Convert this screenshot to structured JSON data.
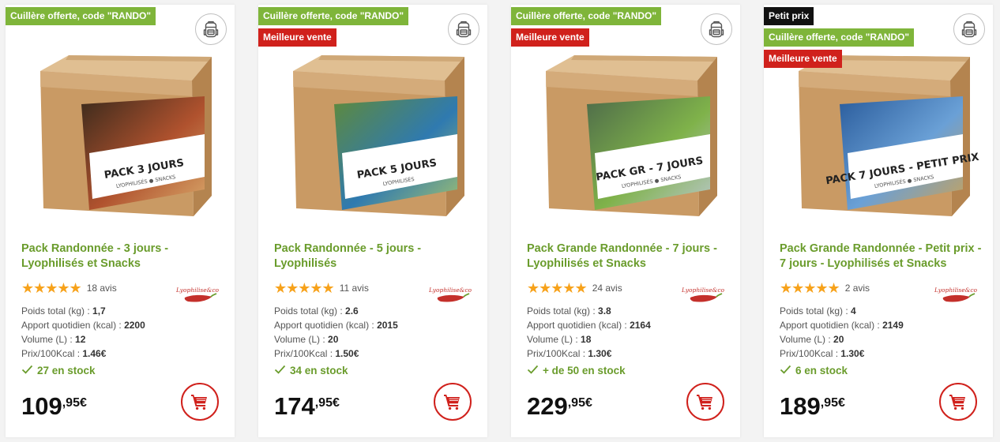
{
  "products": [
    {
      "badges": [
        {
          "type": "promo",
          "text": "Cuillère offerte, code \"RANDO\""
        }
      ],
      "title": "Pack Randonnée - 3 jours - Lyophilisés et Snacks",
      "box_label_line1": "PACK 3 JOURS",
      "box_label_line2": "LYOPHILISÉS ● SNACKS",
      "stars": "★★★★★",
      "reviews": "18 avis",
      "brand_name": "Lyophilise&co",
      "specs": [
        {
          "label": "Poids total (kg) : ",
          "value": "1,7"
        },
        {
          "label": "Apport quotidien (kcal) : ",
          "value": "2200"
        },
        {
          "label": "Volume (L) : ",
          "value": "12"
        },
        {
          "label": "Prix/100Kcal : ",
          "value": "1.46€"
        }
      ],
      "stock": "27 en stock",
      "price_int": "109",
      "price_dec": ",95€",
      "photo_colors": [
        "#3a2a1c",
        "#b0522e",
        "#d9a86a"
      ]
    },
    {
      "badges": [
        {
          "type": "promo",
          "text": "Cuillère offerte, code \"RANDO\""
        },
        {
          "type": "best",
          "text": "Meilleure vente"
        }
      ],
      "title": "Pack Randonnée - 5 jours - Lyophilisés",
      "box_label_line1": "PACK 5 JOURS",
      "box_label_line2": "LYOPHILISÉS",
      "stars": "★★★★★",
      "reviews": "11 avis",
      "brand_name": "Lyophilise&co",
      "specs": [
        {
          "label": "Poids total (kg) : ",
          "value": "2.6"
        },
        {
          "label": "Apport quotidien (kcal) : ",
          "value": "2015"
        },
        {
          "label": "Volume (L) : ",
          "value": "20"
        },
        {
          "label": "Prix/100Kcal : ",
          "value": "1.50€"
        }
      ],
      "stock": "34 en stock",
      "price_int": "174",
      "price_dec": ",95€",
      "photo_colors": [
        "#5f8a3a",
        "#2f7ab0",
        "#9fc071"
      ]
    },
    {
      "badges": [
        {
          "type": "promo",
          "text": "Cuillère offerte, code \"RANDO\""
        },
        {
          "type": "best",
          "text": "Meilleure vente"
        }
      ],
      "title": "Pack Grande Randonnée - 7 jours - Lyophilisés et Snacks",
      "box_label_line1": "PACK GR - 7 JOURS",
      "box_label_line2": "LYOPHILISÉS ● SNACKS",
      "stars": "★★★★★",
      "reviews": "24 avis",
      "brand_name": "Lyophilise&co",
      "specs": [
        {
          "label": "Poids total (kg) : ",
          "value": "3.8"
        },
        {
          "label": "Apport quotidien (kcal) : ",
          "value": "2164"
        },
        {
          "label": "Volume (L) : ",
          "value": "18"
        },
        {
          "label": "Prix/100Kcal : ",
          "value": "1.30€"
        }
      ],
      "stock": "+ de 50 en stock",
      "price_int": "229",
      "price_dec": ",95€",
      "photo_colors": [
        "#4e6b4a",
        "#7fb24a",
        "#b9c7c9"
      ]
    },
    {
      "badges": [
        {
          "type": "cheap",
          "text": "Petit prix"
        },
        {
          "type": "promo",
          "text": "Cuillère offerte, code \"RANDO\""
        },
        {
          "type": "best",
          "text": "Meilleure vente"
        }
      ],
      "title": "Pack Grande Randonnée - Petit prix - 7 jours - Lyophilisés et Snacks",
      "box_label_line1": "PACK 7 JOURS - PETIT PRIX",
      "box_label_line2": "LYOPHILISÉS ● SNACKS",
      "stars": "★★★★★",
      "reviews": "2 avis",
      "brand_name": "Lyophilise&co",
      "specs": [
        {
          "label": "Poids total (kg) : ",
          "value": "4"
        },
        {
          "label": "Apport quotidien (kcal) : ",
          "value": "2149"
        },
        {
          "label": "Volume (L) : ",
          "value": "20"
        },
        {
          "label": "Prix/100Kcal : ",
          "value": "1.30€"
        }
      ],
      "stock": "6 en stock",
      "price_int": "189",
      "price_dec": ",95€",
      "photo_colors": [
        "#2a5c9c",
        "#6aa0d6",
        "#c8a25a"
      ]
    }
  ],
  "colors": {
    "accent_green": "#6a9c2c",
    "promo_green": "#7fb53a",
    "best_red": "#d0211c",
    "star_orange": "#f7a21b"
  },
  "icons": {
    "backpack": "backpack-icon",
    "cart": "cart-icon",
    "check": "check-icon",
    "brand": "chili-pepper-logo"
  }
}
